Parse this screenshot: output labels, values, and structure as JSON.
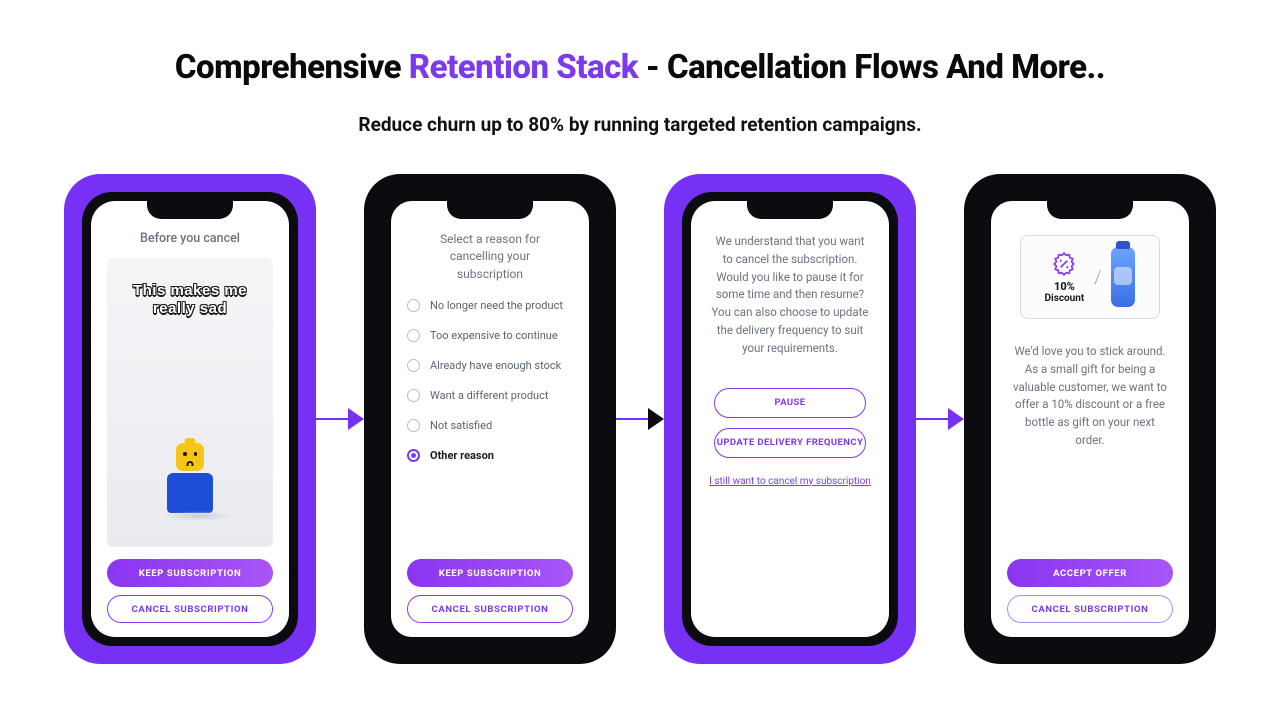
{
  "headline": {
    "pre": "Comprehensive ",
    "accent": "Retention Stack",
    "post": " - Cancellation Flows And More.."
  },
  "subhead": "Reduce churn up to 80% by running targeted retention campaigns.",
  "card1": {
    "title": "Before you cancel",
    "meme_line1": "This makes me",
    "meme_line2": "really sad",
    "keep": "KEEP SUBSCRIPTION",
    "cancel": "CANCEL SUBSCRIPTION"
  },
  "card2": {
    "title": "Select a reason for cancelling your subscription",
    "options": [
      "No longer need the product",
      "Too expensive to continue",
      "Already have enough stock",
      "Want a different product",
      "Not satisfied",
      "Other reason"
    ],
    "selected_index": 5,
    "keep": "KEEP SUBSCRIPTION",
    "cancel": "CANCEL SUBSCRIPTION"
  },
  "card3": {
    "paragraph": "We understand that you want to cancel the subscription. Would you like to pause it for some time and then resume? You can also choose to update the delivery frequency to suit your requirements.",
    "pause": "PAUSE",
    "update": "UPDATE DELIVERY FREQUENCY",
    "still_cancel": "I still want to cancel my subscription"
  },
  "card4": {
    "discount_label_1": "10%",
    "discount_label_2": "Discount",
    "paragraph": "We'd love you to stick around. As a small gift for being a valuable customer, we want to offer a 10% discount or a free bottle as gift on your next order.",
    "accept": "ACCEPT OFFER",
    "cancel": "CANCEL SUBSCRIPTION"
  }
}
